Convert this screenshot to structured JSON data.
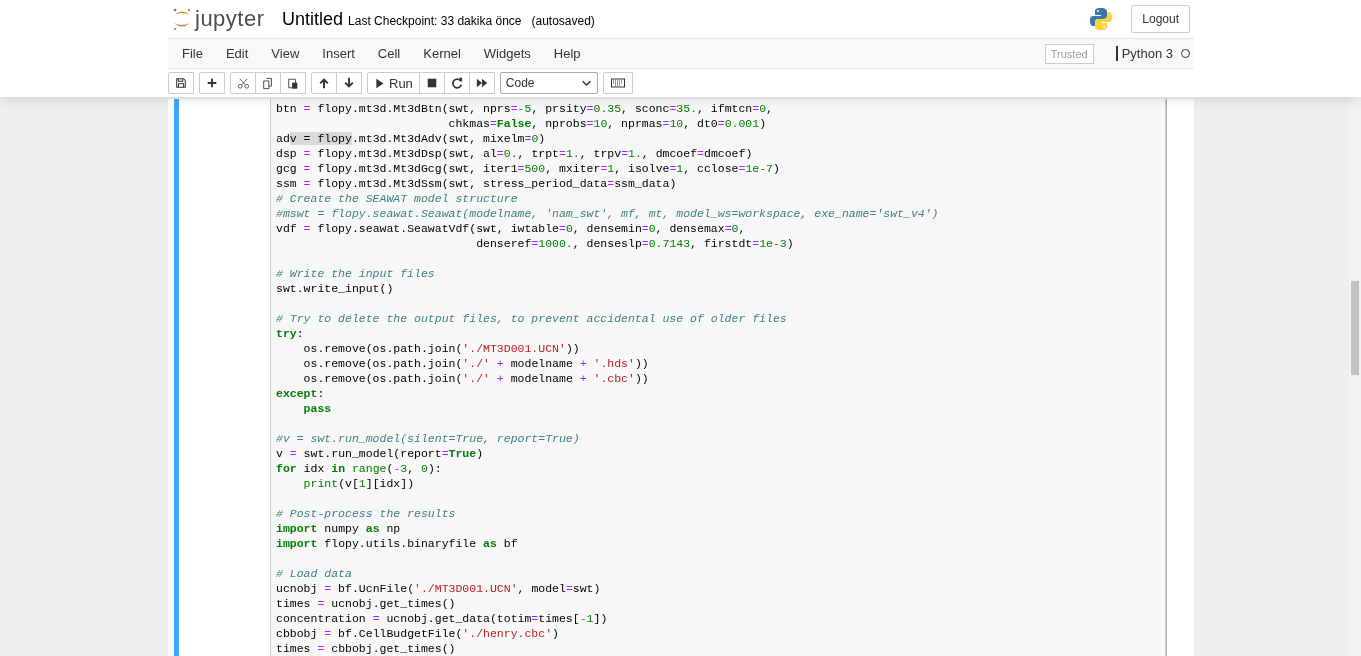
{
  "header": {
    "logo_text": "jupyter",
    "notebook_name": "Untitled",
    "checkpoint": "Last Checkpoint: 33 dakika önce",
    "autosave": "(autosaved)",
    "logout": "Logout"
  },
  "menu": [
    "File",
    "Edit",
    "View",
    "Insert",
    "Cell",
    "Kernel",
    "Widgets",
    "Help"
  ],
  "status": {
    "trusted": "Trusted",
    "kernel_name": "Python 3"
  },
  "toolbar": {
    "run_label": "Run",
    "cell_type": "Code"
  },
  "code_blocks": [
    [
      [
        {
          "kind": "p",
          "text": "btn "
        },
        {
          "kind": "o",
          "text": "="
        },
        {
          "kind": "p",
          "text": " flopy.mt3d.Mt3dBtn(swt, nprs"
        },
        {
          "kind": "o",
          "text": "=-"
        },
        {
          "kind": "n",
          "text": "5"
        },
        {
          "kind": "p",
          "text": ", prsity"
        },
        {
          "kind": "o",
          "text": "="
        },
        {
          "kind": "n",
          "text": "0.35"
        },
        {
          "kind": "p",
          "text": ", sconc"
        },
        {
          "kind": "o",
          "text": "="
        },
        {
          "kind": "n",
          "text": "35."
        },
        {
          "kind": "p",
          "text": ", ifmtcn"
        },
        {
          "kind": "o",
          "text": "="
        },
        {
          "kind": "n",
          "text": "0"
        },
        {
          "kind": "p",
          "text": ","
        }
      ],
      [
        {
          "kind": "p",
          "text": "                         chkmas"
        },
        {
          "kind": "o",
          "text": "="
        },
        {
          "kind": "k",
          "text": "False"
        },
        {
          "kind": "p",
          "text": ", nprobs"
        },
        {
          "kind": "o",
          "text": "="
        },
        {
          "kind": "n",
          "text": "10"
        },
        {
          "kind": "p",
          "text": ", nprmas"
        },
        {
          "kind": "o",
          "text": "="
        },
        {
          "kind": "n",
          "text": "10"
        },
        {
          "kind": "p",
          "text": ", dt0"
        },
        {
          "kind": "o",
          "text": "="
        },
        {
          "kind": "n",
          "text": "0.001"
        },
        {
          "kind": "p",
          "text": ")"
        }
      ],
      [
        {
          "kind": "p",
          "text": "ad"
        },
        {
          "kind": "sel",
          "text": "v = flopy"
        },
        {
          "kind": "p",
          "text": ".mt3d.Mt3dAdv(swt, mixelm"
        },
        {
          "kind": "o",
          "text": "="
        },
        {
          "kind": "n",
          "text": "0"
        },
        {
          "kind": "p",
          "text": ")"
        }
      ],
      [
        {
          "kind": "p",
          "text": "dsp "
        },
        {
          "kind": "o",
          "text": "="
        },
        {
          "kind": "p",
          "text": " flopy.mt3d.Mt3dDsp(swt, al"
        },
        {
          "kind": "o",
          "text": "="
        },
        {
          "kind": "n",
          "text": "0."
        },
        {
          "kind": "p",
          "text": ", trpt"
        },
        {
          "kind": "o",
          "text": "="
        },
        {
          "kind": "n",
          "text": "1."
        },
        {
          "kind": "p",
          "text": ", trpv"
        },
        {
          "kind": "o",
          "text": "="
        },
        {
          "kind": "n",
          "text": "1."
        },
        {
          "kind": "p",
          "text": ", dmcoef"
        },
        {
          "kind": "o",
          "text": "="
        },
        {
          "kind": "p",
          "text": "dmcoef)"
        }
      ],
      [
        {
          "kind": "p",
          "text": "gcg "
        },
        {
          "kind": "o",
          "text": "="
        },
        {
          "kind": "p",
          "text": " flopy.mt3d.Mt3dGcg(swt, iter1"
        },
        {
          "kind": "o",
          "text": "="
        },
        {
          "kind": "n",
          "text": "500"
        },
        {
          "kind": "p",
          "text": ", mxiter"
        },
        {
          "kind": "o",
          "text": "="
        },
        {
          "kind": "n",
          "text": "1"
        },
        {
          "kind": "p",
          "text": ", isolve"
        },
        {
          "kind": "o",
          "text": "="
        },
        {
          "kind": "n",
          "text": "1"
        },
        {
          "kind": "p",
          "text": ", cclose"
        },
        {
          "kind": "o",
          "text": "="
        },
        {
          "kind": "n",
          "text": "1e-7"
        },
        {
          "kind": "p",
          "text": ")"
        }
      ],
      [
        {
          "kind": "p",
          "text": "ssm "
        },
        {
          "kind": "o",
          "text": "="
        },
        {
          "kind": "p",
          "text": " flopy.mt3d.Mt3dSsm(swt, stress_period_data"
        },
        {
          "kind": "o",
          "text": "="
        },
        {
          "kind": "p",
          "text": "ssm_data)"
        }
      ],
      [
        {
          "kind": "c",
          "text": "# Create the SEAWAT model structure"
        }
      ],
      [
        {
          "kind": "c",
          "text": "#mswt = flopy.seawat.Seawat(modelname, 'nam_swt', mf, mt, model_ws=workspace, exe_name='swt_v4')"
        }
      ],
      [
        {
          "kind": "p",
          "text": "vdf "
        },
        {
          "kind": "o",
          "text": "="
        },
        {
          "kind": "p",
          "text": " flopy.seawat.SeawatVdf(swt, iwtable"
        },
        {
          "kind": "o",
          "text": "="
        },
        {
          "kind": "n",
          "text": "0"
        },
        {
          "kind": "p",
          "text": ", densemin"
        },
        {
          "kind": "o",
          "text": "="
        },
        {
          "kind": "n",
          "text": "0"
        },
        {
          "kind": "p",
          "text": ", densemax"
        },
        {
          "kind": "o",
          "text": "="
        },
        {
          "kind": "n",
          "text": "0"
        },
        {
          "kind": "p",
          "text": ","
        }
      ],
      [
        {
          "kind": "p",
          "text": "                             denseref"
        },
        {
          "kind": "o",
          "text": "="
        },
        {
          "kind": "n",
          "text": "1000."
        },
        {
          "kind": "p",
          "text": ", denseslp"
        },
        {
          "kind": "o",
          "text": "="
        },
        {
          "kind": "n",
          "text": "0.7143"
        },
        {
          "kind": "p",
          "text": ", firstdt"
        },
        {
          "kind": "o",
          "text": "="
        },
        {
          "kind": "n",
          "text": "1e-3"
        },
        {
          "kind": "p",
          "text": ")"
        }
      ]
    ],
    [
      [
        {
          "kind": "c",
          "text": "# Write the input files"
        }
      ],
      [
        {
          "kind": "p",
          "text": "swt.write_input()"
        }
      ]
    ],
    [
      [
        {
          "kind": "c",
          "text": "# Try to delete the output files, to prevent accidental use of older files"
        }
      ],
      [
        {
          "kind": "k",
          "text": "try"
        },
        {
          "kind": "p",
          "text": ":"
        }
      ],
      [
        {
          "kind": "p",
          "text": "    os.remove(os.path.join("
        },
        {
          "kind": "s",
          "text": "'./MT3D001.UCN'"
        },
        {
          "kind": "p",
          "text": "))"
        }
      ],
      [
        {
          "kind": "p",
          "text": "    os.remove(os.path.join("
        },
        {
          "kind": "s",
          "text": "'./'"
        },
        {
          "kind": "o",
          "text": " + "
        },
        {
          "kind": "p",
          "text": "modelname"
        },
        {
          "kind": "o",
          "text": " + "
        },
        {
          "kind": "s",
          "text": "'.hds'"
        },
        {
          "kind": "p",
          "text": "))"
        }
      ],
      [
        {
          "kind": "p",
          "text": "    os.remove(os.path.join("
        },
        {
          "kind": "s",
          "text": "'./'"
        },
        {
          "kind": "o",
          "text": " + "
        },
        {
          "kind": "p",
          "text": "modelname"
        },
        {
          "kind": "o",
          "text": " + "
        },
        {
          "kind": "s",
          "text": "'.cbc'"
        },
        {
          "kind": "p",
          "text": "))"
        }
      ],
      [
        {
          "kind": "k",
          "text": "except"
        },
        {
          "kind": "p",
          "text": ":"
        }
      ],
      [
        {
          "kind": "k",
          "text": "    pass"
        }
      ]
    ],
    [
      [
        {
          "kind": "c",
          "text": "#v = swt.run_model(silent=True, report=True)"
        }
      ],
      [
        {
          "kind": "p",
          "text": "v "
        },
        {
          "kind": "o",
          "text": "="
        },
        {
          "kind": "p",
          "text": " swt.run_model(report"
        },
        {
          "kind": "o",
          "text": "="
        },
        {
          "kind": "k",
          "text": "True"
        },
        {
          "kind": "p",
          "text": ")"
        }
      ],
      [
        {
          "kind": "k",
          "text": "for"
        },
        {
          "kind": "p",
          "text": " idx "
        },
        {
          "kind": "k",
          "text": "in"
        },
        {
          "kind": "b",
          "text": " range"
        },
        {
          "kind": "p",
          "text": "("
        },
        {
          "kind": "o",
          "text": "-"
        },
        {
          "kind": "n",
          "text": "3"
        },
        {
          "kind": "p",
          "text": ", "
        },
        {
          "kind": "n",
          "text": "0"
        },
        {
          "kind": "p",
          "text": "):"
        }
      ],
      [
        {
          "kind": "b",
          "text": "    print"
        },
        {
          "kind": "p",
          "text": "(v["
        },
        {
          "kind": "n",
          "text": "1"
        },
        {
          "kind": "p",
          "text": "][idx])"
        }
      ]
    ],
    [
      [
        {
          "kind": "c",
          "text": "# Post-process the results"
        }
      ],
      [
        {
          "kind": "k",
          "text": "import"
        },
        {
          "kind": "p",
          "text": " numpy "
        },
        {
          "kind": "k",
          "text": "as"
        },
        {
          "kind": "p",
          "text": " np"
        }
      ],
      [
        {
          "kind": "k",
          "text": "import"
        },
        {
          "kind": "p",
          "text": " flopy.utils.binaryfile "
        },
        {
          "kind": "k",
          "text": "as"
        },
        {
          "kind": "p",
          "text": " bf"
        }
      ]
    ],
    [
      [
        {
          "kind": "c",
          "text": "# Load data"
        }
      ],
      [
        {
          "kind": "p",
          "text": "ucnobj "
        },
        {
          "kind": "o",
          "text": "="
        },
        {
          "kind": "p",
          "text": " bf.UcnFile("
        },
        {
          "kind": "s",
          "text": "'./MT3D001.UCN'"
        },
        {
          "kind": "p",
          "text": ", model"
        },
        {
          "kind": "o",
          "text": "="
        },
        {
          "kind": "p",
          "text": "swt)"
        }
      ],
      [
        {
          "kind": "p",
          "text": "times "
        },
        {
          "kind": "o",
          "text": "="
        },
        {
          "kind": "p",
          "text": " ucnobj.get_times()"
        }
      ],
      [
        {
          "kind": "p",
          "text": "concentration "
        },
        {
          "kind": "o",
          "text": "="
        },
        {
          "kind": "p",
          "text": " ucnobj.get_data(totim"
        },
        {
          "kind": "o",
          "text": "="
        },
        {
          "kind": "p",
          "text": "times["
        },
        {
          "kind": "o",
          "text": "-"
        },
        {
          "kind": "n",
          "text": "1"
        },
        {
          "kind": "p",
          "text": "])"
        }
      ],
      [
        {
          "kind": "p",
          "text": "cbbobj "
        },
        {
          "kind": "o",
          "text": "="
        },
        {
          "kind": "p",
          "text": " bf.CellBudgetFile("
        },
        {
          "kind": "s",
          "text": "'./henry.cbc'"
        },
        {
          "kind": "p",
          "text": ")"
        }
      ],
      [
        {
          "kind": "p",
          "text": "times "
        },
        {
          "kind": "o",
          "text": "="
        },
        {
          "kind": "p",
          "text": " cbbobj.get_times()"
        }
      ]
    ]
  ]
}
